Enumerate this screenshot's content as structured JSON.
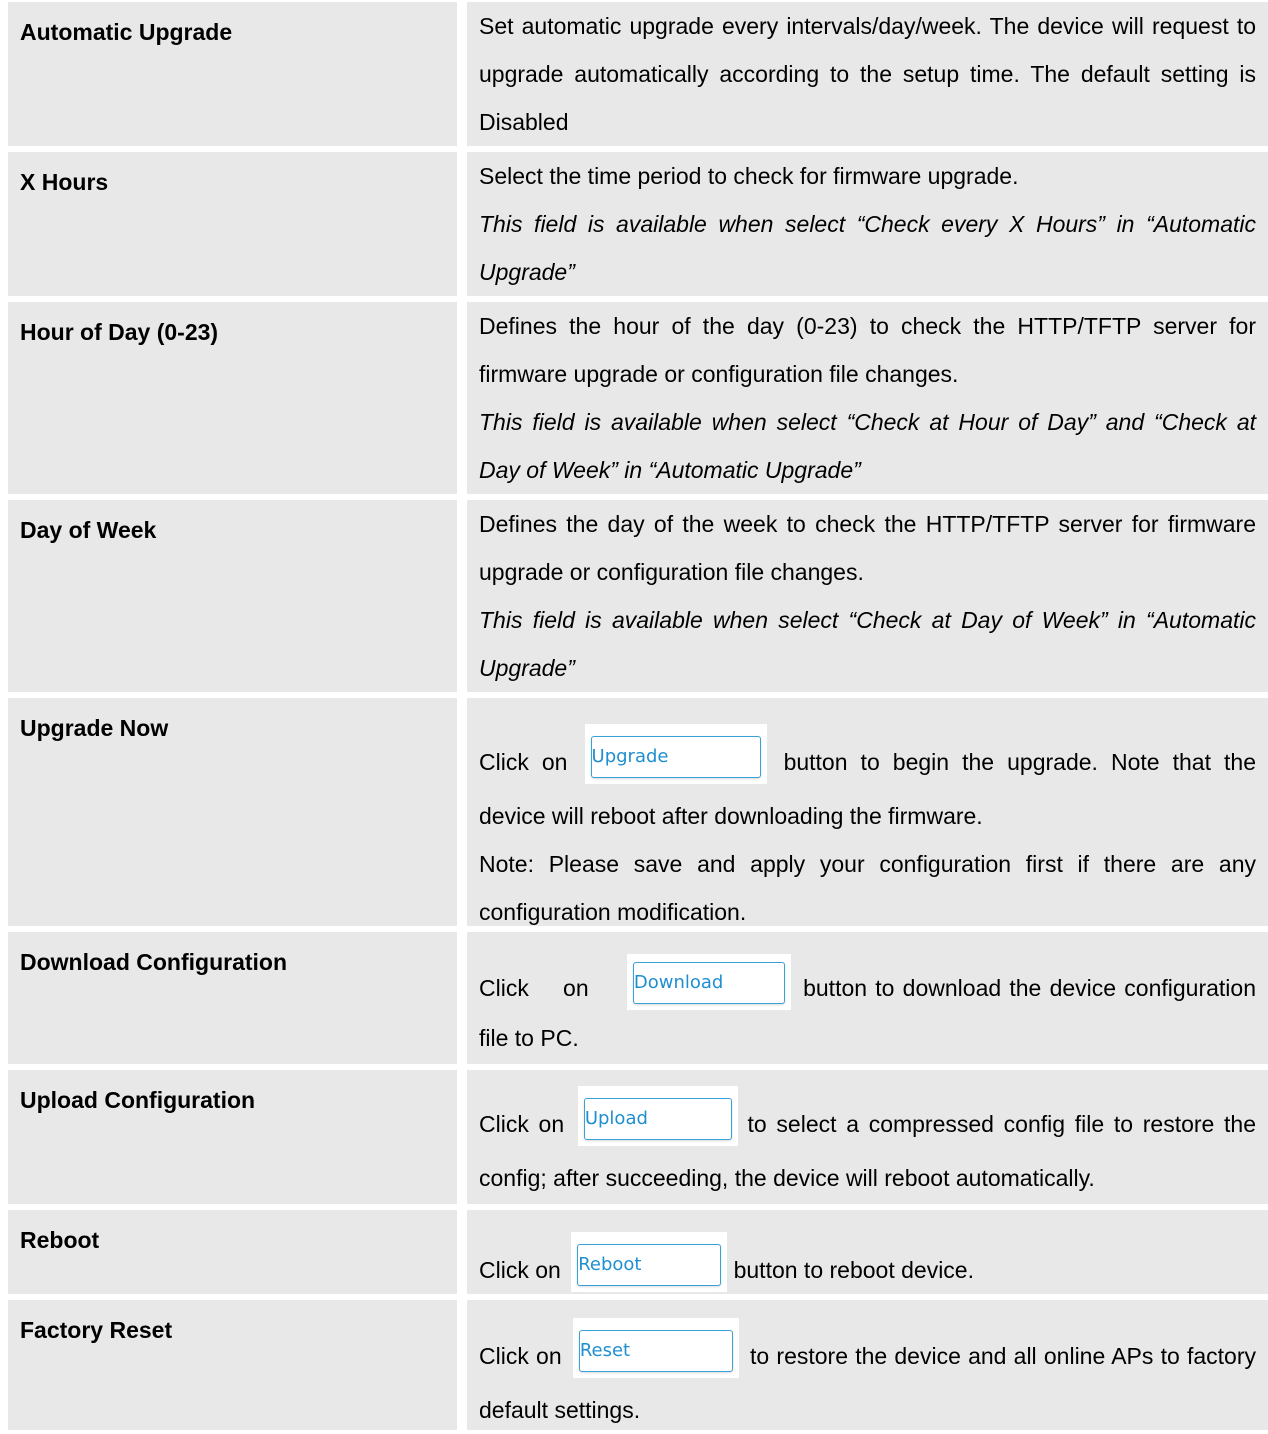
{
  "rows": [
    {
      "name": "Automatic Upgrade",
      "lines": [
        "Set automatic upgrade every intervals/day/week. The device will request to upgrade automatically according to the setup time. The default setting is Disabled"
      ]
    },
    {
      "name": "X Hours",
      "lines": [
        "Select the time period to check for firmware upgrade."
      ],
      "note": "This field is available when select “Check every X Hours” in “Automatic Upgrade”"
    },
    {
      "name": "Hour of Day (0-23)",
      "lines": [
        "Defines the hour of the day (0-23) to check the HTTP/TFTP server for firmware upgrade or configuration file changes."
      ],
      "note": "This field is available when select “Check at Hour of Day” and “Check at Day of Week” in “Automatic Upgrade”"
    },
    {
      "name": "Day of Week",
      "lines": [
        "Defines the day of the week to check the HTTP/TFTP server for firmware upgrade or configuration file changes."
      ],
      "note": "This field is available when select “Check at Day of Week” in “Automatic Upgrade”"
    },
    {
      "name": "Upgrade Now",
      "prefix": "Click on",
      "button": "Upgrade",
      "suffix": "button to begin the upgrade. Note that the device will reboot after downloading the firmware.",
      "extra": "Note: Please save and apply your configuration first if there are any configuration modification."
    },
    {
      "name": "Download Configuration",
      "prefix": "Click on",
      "button": "Download",
      "suffix": "button to download the device configuration file to PC."
    },
    {
      "name": "Upload Configuration",
      "prefix": "Click on",
      "button": "Upload",
      "suffix": "to select a compressed config file to restore the config; after succeeding, the device will reboot automatically."
    },
    {
      "name": "Reboot",
      "prefix": "Click on",
      "button": "Reboot",
      "suffix": "button to reboot device."
    },
    {
      "name": "Factory Reset",
      "prefix": "Click on",
      "button": "Reset",
      "suffix": "to restore the device and all online APs to factory default settings."
    }
  ]
}
